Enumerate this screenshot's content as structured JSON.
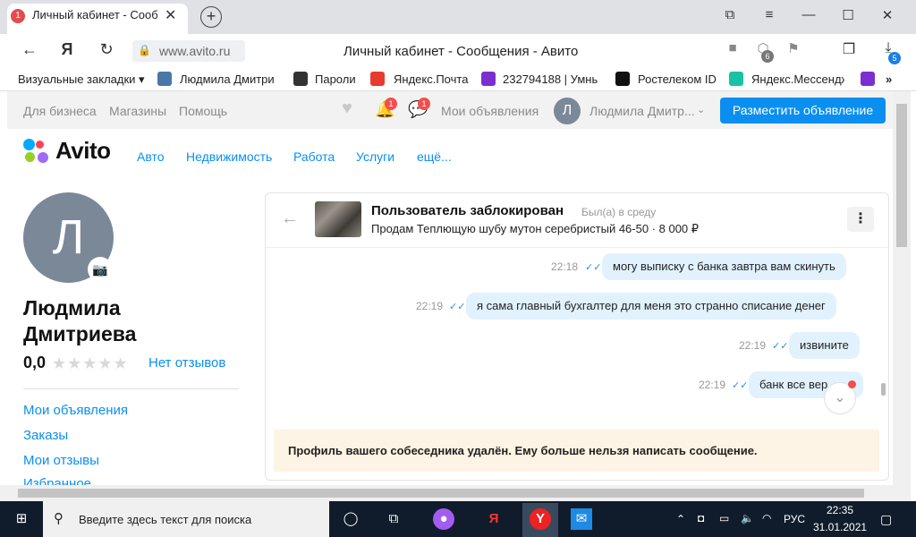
{
  "browser": {
    "tab_badge": "1",
    "tab_title": "Личный кабинет - Сооб",
    "url": "www.avito.ru",
    "page_title": "Личный кабинет - Сообщения - Авито",
    "download_badge": "5",
    "ext_badge": "6"
  },
  "bookmarks": [
    "Визуальные закладки ▾",
    "Людмила Дмитри",
    "Пароли",
    "Яндекс.Почта",
    "232794188 | Умны",
    "Ростелеком ID",
    "Яндекс.Мессендж"
  ],
  "avito_top": {
    "links": [
      "Для бизнеса",
      "Магазины",
      "Помощь"
    ],
    "my_ads": "Мои объявления",
    "user": "Людмила Дмитр...",
    "avatar_letter": "Л",
    "post_button": "Разместить объявление",
    "notif_badge": "1",
    "msg_badge": "1"
  },
  "avito_nav": {
    "logo": "Avito",
    "items": [
      "Авто",
      "Недвижимость",
      "Работа",
      "Услуги",
      "ещё..."
    ]
  },
  "profile": {
    "avatar_letter": "Л",
    "name": "Людмила Дмитриева",
    "rating": "0,0",
    "stars": "★★★★★",
    "reviews": "Нет отзывов",
    "menu": [
      "Мои объявления",
      "Заказы",
      "Мои отзывы",
      "Избранное"
    ]
  },
  "chat": {
    "user": "Пользователь заблокирован",
    "last_seen": "Был(а) в среду",
    "item": "Продам Теплющую шубу мутон серебристый 46-50 · 8 000 ₽",
    "messages": [
      {
        "time": "22:18",
        "text": "могу выписку с банка завтра вам скинуть"
      },
      {
        "time": "22:19",
        "text": "я сама главный бухгалтер для меня это странно списание денег"
      },
      {
        "time": "22:19",
        "text": "извините"
      },
      {
        "time": "22:19",
        "text": "банк все вер"
      }
    ],
    "notice": "Профиль вашего собеседника удалён. Ему больше нельзя написать сообщение."
  },
  "taskbar": {
    "search_placeholder": "Введите здесь текст для поиска",
    "lang": "РУС",
    "time": "22:35",
    "date": "31.01.2021"
  }
}
